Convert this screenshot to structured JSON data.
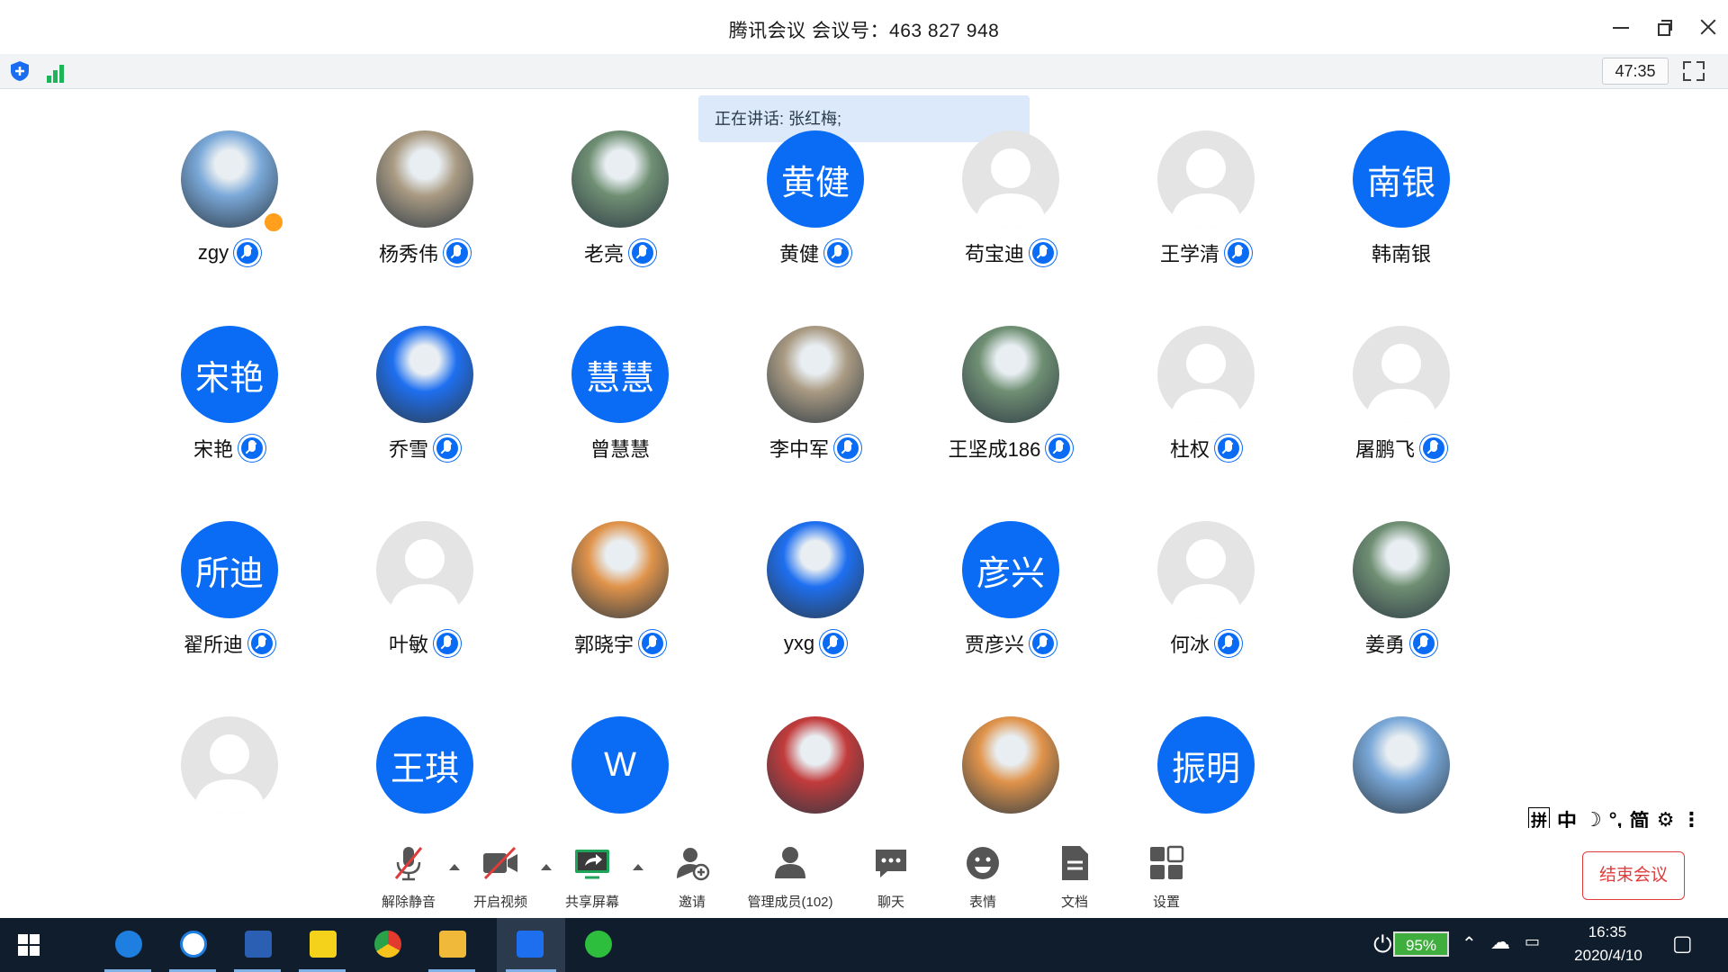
{
  "window": {
    "title": "腾讯会议 会议号：463 827 948"
  },
  "status": {
    "timer": "47:35",
    "speaking": "正在讲话: 张红梅;"
  },
  "participants": [
    {
      "name": "zgy",
      "avatar_text": "",
      "avatar_type": "photo",
      "host": true
    },
    {
      "name": "杨秀伟",
      "avatar_text": "",
      "avatar_type": "photo"
    },
    {
      "name": "老亮",
      "avatar_text": "",
      "avatar_type": "photo"
    },
    {
      "name": "黄健",
      "avatar_text": "黄健",
      "avatar_type": "text"
    },
    {
      "name": "苟宝迪",
      "avatar_text": "",
      "avatar_type": "default"
    },
    {
      "name": "王学清",
      "avatar_text": "",
      "avatar_type": "default"
    },
    {
      "name": "韩南银",
      "avatar_text": "南银",
      "avatar_type": "text",
      "mic": false
    },
    {
      "name": "宋艳",
      "avatar_text": "宋艳",
      "avatar_type": "text"
    },
    {
      "name": "乔雪",
      "avatar_text": "",
      "avatar_type": "photo"
    },
    {
      "name": "曾慧慧",
      "avatar_text": "慧慧",
      "avatar_type": "text",
      "mic": false
    },
    {
      "name": "李中军",
      "avatar_text": "",
      "avatar_type": "photo"
    },
    {
      "name": "王坚成186",
      "avatar_text": "",
      "avatar_type": "photo"
    },
    {
      "name": "杜权",
      "avatar_text": "",
      "avatar_type": "default"
    },
    {
      "name": "屠鹏飞",
      "avatar_text": "",
      "avatar_type": "default"
    },
    {
      "name": "翟所迪",
      "avatar_text": "所迪",
      "avatar_type": "text"
    },
    {
      "name": "叶敏",
      "avatar_text": "",
      "avatar_type": "default"
    },
    {
      "name": "郭晓宇",
      "avatar_text": "",
      "avatar_type": "photo"
    },
    {
      "name": "yxg",
      "avatar_text": "",
      "avatar_type": "photo"
    },
    {
      "name": "贾彦兴",
      "avatar_text": "彦兴",
      "avatar_type": "text"
    },
    {
      "name": "何冰",
      "avatar_text": "",
      "avatar_type": "default"
    },
    {
      "name": "姜勇",
      "avatar_text": "",
      "avatar_type": "photo"
    },
    {
      "name": "",
      "avatar_text": "",
      "avatar_type": "default",
      "mic": false
    },
    {
      "name": "",
      "avatar_text": "王琪",
      "avatar_type": "text",
      "mic": false
    },
    {
      "name": "",
      "avatar_text": "W",
      "avatar_type": "text",
      "mic": false
    },
    {
      "name": "",
      "avatar_text": "",
      "avatar_type": "photo",
      "mic": false
    },
    {
      "name": "",
      "avatar_text": "",
      "avatar_type": "photo",
      "mic": false
    },
    {
      "name": "",
      "avatar_text": "振明",
      "avatar_type": "text",
      "mic": false
    },
    {
      "name": "",
      "avatar_text": "",
      "avatar_type": "photo",
      "mic": false
    }
  ],
  "toolbar": {
    "unmute": "解除静音",
    "video": "开启视频",
    "share": "共享屏幕",
    "invite": "邀请",
    "members": "管理成员(102)",
    "chat": "聊天",
    "emoji": "表情",
    "docs": "文档",
    "settings": "设置",
    "end": "结束会议"
  },
  "ime": {
    "layout": "拼",
    "lang": "中",
    "mode": "简"
  },
  "taskbar": {
    "battery": "95%",
    "time": "16:35",
    "date": "2020/4/10"
  },
  "colors": {
    "accent": "#0a6cf5",
    "end": "#e03c3c",
    "taskbar": "#0f1d2d"
  }
}
